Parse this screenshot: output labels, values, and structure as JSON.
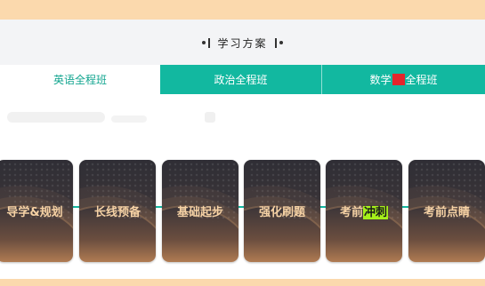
{
  "section": {
    "title": "学习方案"
  },
  "tabs": [
    {
      "label": "英语全程班",
      "active": true
    },
    {
      "label": "政治全程班",
      "active": false
    },
    {
      "label_before": "数学",
      "label_after": "全程班",
      "active": false
    }
  ],
  "stages": [
    {
      "label": "导学&规划"
    },
    {
      "label": "长线预备"
    },
    {
      "label": "基础起步"
    },
    {
      "label": "强化刷题"
    },
    {
      "label_before": "考前",
      "label_highlight": "冲刺"
    },
    {
      "label": "考前点睛"
    }
  ],
  "colors": {
    "accent": "#12b8a0",
    "accent_text": "#12a58f",
    "page_band": "#fbd9ad",
    "card_text": "#f6d2a5",
    "highlight": "#a6f01a",
    "redaction": "#e4252b"
  }
}
